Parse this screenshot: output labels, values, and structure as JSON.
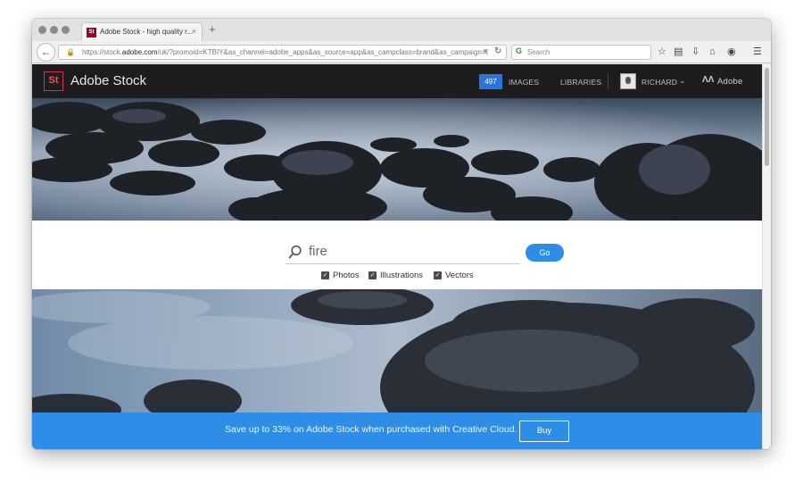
{
  "browser": {
    "tab_title": "Adobe Stock - high quality r...",
    "tab_favicon_text": "St",
    "tab_close": "×",
    "new_tab": "+",
    "url_prefix": "https://stock.",
    "url_domain": "adobe.com",
    "url_rest": "/uk/?promoid=KTBIY&as_channel=adobe_apps&as_source=app&as_campclass=brand&as_campaign=CC",
    "search_placeholder": "Search"
  },
  "header": {
    "logo_text": "St",
    "brand": "Adobe Stock",
    "images_count": "497",
    "images_label": "IMAGES",
    "libraries_label": "LIBRARIES",
    "user_name": "RICHARD",
    "adobe_label": "Adobe"
  },
  "search": {
    "query": "fire",
    "go_label": "Go",
    "filters": [
      {
        "label": "Photos",
        "checked": true
      },
      {
        "label": "Illustrations",
        "checked": true
      },
      {
        "label": "Vectors",
        "checked": true
      }
    ]
  },
  "promo": {
    "text": "Save up to 33% on Adobe Stock when purchased with Creative Cloud.",
    "buy_label": "Buy"
  },
  "colors": {
    "header_bg": "#1d1d1f",
    "accent_blue": "#2d8ce6",
    "logo_red": "#dd2b4a"
  }
}
